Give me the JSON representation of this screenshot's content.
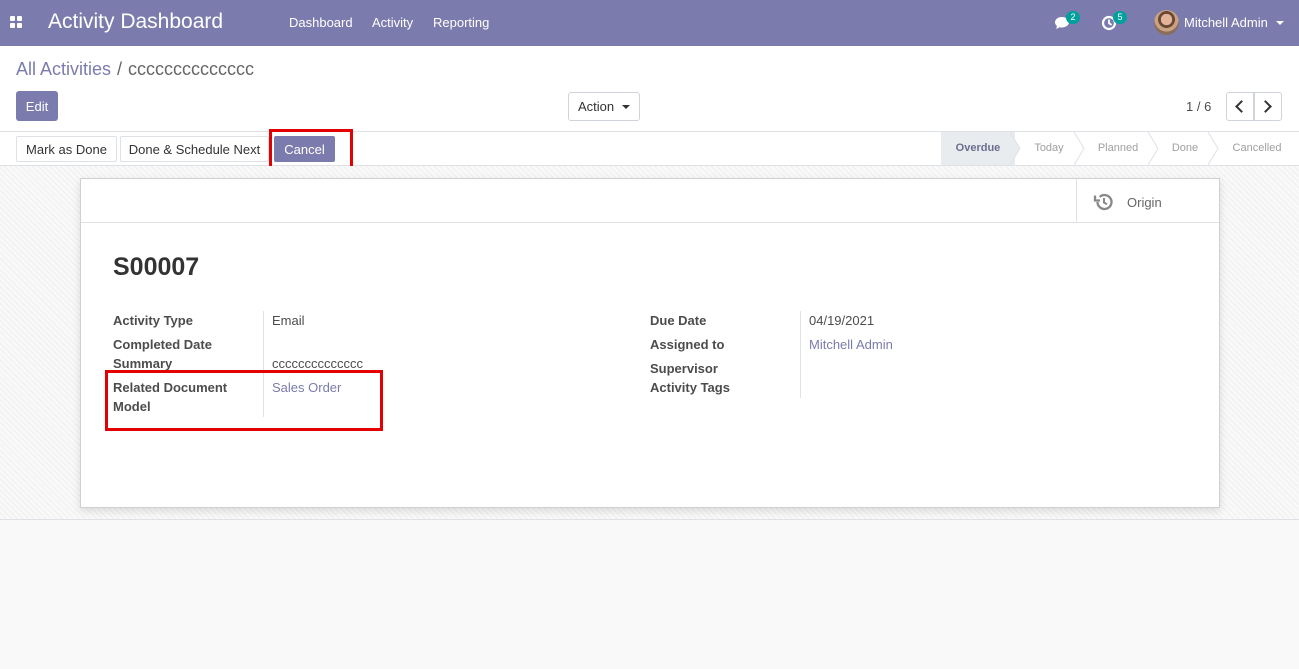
{
  "navbar": {
    "app_title": "Activity Dashboard",
    "menu": [
      "Dashboard",
      "Activity",
      "Reporting"
    ],
    "messages_badge": "2",
    "activities_badge": "5",
    "user_name": "Mitchell Admin"
  },
  "breadcrumb": {
    "parent": "All Activities",
    "separator": "/",
    "current": "cccccccccccccc"
  },
  "buttons": {
    "edit": "Edit",
    "action": "Action"
  },
  "pager": {
    "value": "1 / 6"
  },
  "header_buttons": {
    "mark_done": "Mark as Done",
    "done_schedule": "Done & Schedule Next",
    "cancel": "Cancel"
  },
  "stages": [
    "Overdue",
    "Today",
    "Planned",
    "Done",
    "Cancelled"
  ],
  "active_stage": "Overdue",
  "smart_button": {
    "label": "Origin",
    "icon": "history-icon"
  },
  "record": {
    "title": "S00007",
    "left_fields": {
      "activity_type_label": "Activity Type",
      "activity_type_value": "Email",
      "completed_date_label": "Completed Date",
      "summary_label": "Summary",
      "summary_value": "cccccccccccccc",
      "related_model_label": "Related Document Model",
      "related_model_value": "Sales Order"
    },
    "right_fields": {
      "due_date_label": "Due Date",
      "due_date_value": "04/19/2021",
      "assigned_to_label": "Assigned to",
      "assigned_to_value": "Mitchell Admin",
      "supervisor_label": "Supervisor",
      "activity_tags_label": "Activity Tags"
    }
  },
  "colors": {
    "brand": "#7c7bad",
    "badge": "#00a09d",
    "highlight": "#e20000"
  }
}
